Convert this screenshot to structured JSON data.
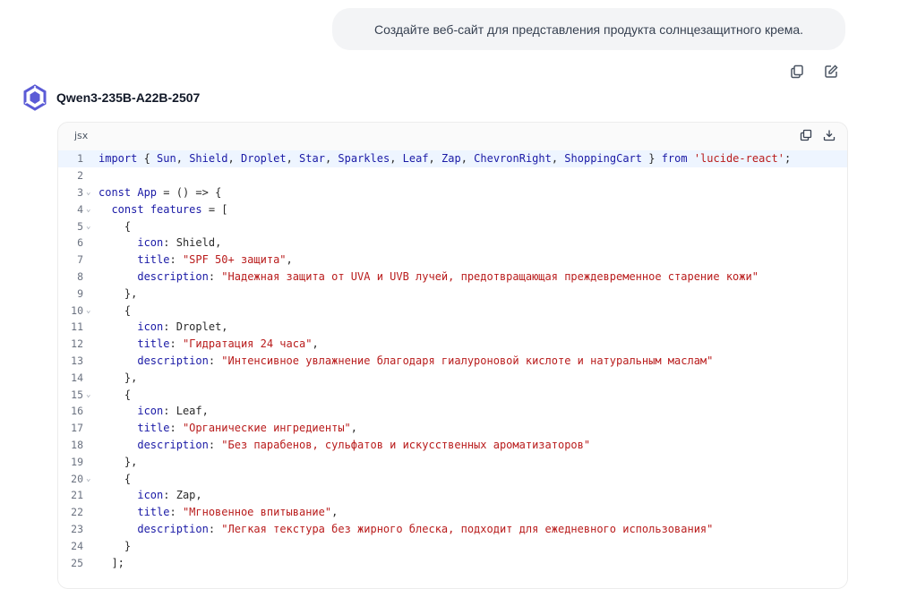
{
  "user_message": "Создайте веб-сайт для представления продукта солнцезащитного крема.",
  "assistant": {
    "model_name": "Qwen3-235B-A22B-2507"
  },
  "icons": {
    "copy": "copy-icon",
    "edit": "edit-icon",
    "download": "download-icon",
    "logo": "qwen-logo-icon",
    "fold": "chevron-down-icon"
  },
  "colors": {
    "keyword": "#1a1aa6",
    "string": "#b91c1c",
    "line_highlight": "#eef5ff",
    "bubble_bg": "#f3f4f6",
    "logo": "#5b5bd6"
  },
  "code_block": {
    "language": "jsx",
    "active_line": 1,
    "lines": [
      {
        "n": "1",
        "fold": false,
        "tokens": [
          [
            "kw",
            "import"
          ],
          [
            "p",
            " { "
          ],
          [
            "id",
            "Sun"
          ],
          [
            "p",
            ", "
          ],
          [
            "id",
            "Shield"
          ],
          [
            "p",
            ", "
          ],
          [
            "id",
            "Droplet"
          ],
          [
            "p",
            ", "
          ],
          [
            "id",
            "Star"
          ],
          [
            "p",
            ", "
          ],
          [
            "id",
            "Sparkles"
          ],
          [
            "p",
            ", "
          ],
          [
            "id",
            "Leaf"
          ],
          [
            "p",
            ", "
          ],
          [
            "id",
            "Zap"
          ],
          [
            "p",
            ", "
          ],
          [
            "id",
            "ChevronRight"
          ],
          [
            "p",
            ", "
          ],
          [
            "id",
            "ShoppingCart"
          ],
          [
            "p",
            " } "
          ],
          [
            "kw",
            "from"
          ],
          [
            "p",
            " "
          ],
          [
            "str",
            "'lucide-react'"
          ],
          [
            "p",
            ";"
          ]
        ]
      },
      {
        "n": "2",
        "fold": false,
        "tokens": []
      },
      {
        "n": "3",
        "fold": true,
        "tokens": [
          [
            "kw",
            "const"
          ],
          [
            "p",
            " "
          ],
          [
            "id",
            "App"
          ],
          [
            "p",
            " = () => {"
          ]
        ]
      },
      {
        "n": "4",
        "fold": true,
        "tokens": [
          [
            "p",
            "  "
          ],
          [
            "kw",
            "const"
          ],
          [
            "p",
            " "
          ],
          [
            "id",
            "features"
          ],
          [
            "p",
            " = ["
          ]
        ]
      },
      {
        "n": "5",
        "fold": true,
        "tokens": [
          [
            "p",
            "    {"
          ]
        ]
      },
      {
        "n": "6",
        "fold": false,
        "tokens": [
          [
            "p",
            "      "
          ],
          [
            "prop",
            "icon"
          ],
          [
            "p",
            ": "
          ],
          [
            "txt",
            "Shield"
          ],
          [
            "p",
            ","
          ]
        ]
      },
      {
        "n": "7",
        "fold": false,
        "tokens": [
          [
            "p",
            "      "
          ],
          [
            "prop",
            "title"
          ],
          [
            "p",
            ": "
          ],
          [
            "str",
            "\"SPF 50+ защита\""
          ],
          [
            "p",
            ","
          ]
        ]
      },
      {
        "n": "8",
        "fold": false,
        "tokens": [
          [
            "p",
            "      "
          ],
          [
            "prop",
            "description"
          ],
          [
            "p",
            ": "
          ],
          [
            "str",
            "\"Надежная защита от UVA и UVB лучей, предотвращающая преждевременное старение кожи\""
          ]
        ]
      },
      {
        "n": "9",
        "fold": false,
        "tokens": [
          [
            "p",
            "    },"
          ]
        ]
      },
      {
        "n": "10",
        "fold": true,
        "tokens": [
          [
            "p",
            "    {"
          ]
        ]
      },
      {
        "n": "11",
        "fold": false,
        "tokens": [
          [
            "p",
            "      "
          ],
          [
            "prop",
            "icon"
          ],
          [
            "p",
            ": "
          ],
          [
            "txt",
            "Droplet"
          ],
          [
            "p",
            ","
          ]
        ]
      },
      {
        "n": "12",
        "fold": false,
        "tokens": [
          [
            "p",
            "      "
          ],
          [
            "prop",
            "title"
          ],
          [
            "p",
            ": "
          ],
          [
            "str",
            "\"Гидратация 24 часа\""
          ],
          [
            "p",
            ","
          ]
        ]
      },
      {
        "n": "13",
        "fold": false,
        "tokens": [
          [
            "p",
            "      "
          ],
          [
            "prop",
            "description"
          ],
          [
            "p",
            ": "
          ],
          [
            "str",
            "\"Интенсивное увлажнение благодаря гиалуроновой кислоте и натуральным маслам\""
          ]
        ]
      },
      {
        "n": "14",
        "fold": false,
        "tokens": [
          [
            "p",
            "    },"
          ]
        ]
      },
      {
        "n": "15",
        "fold": true,
        "tokens": [
          [
            "p",
            "    {"
          ]
        ]
      },
      {
        "n": "16",
        "fold": false,
        "tokens": [
          [
            "p",
            "      "
          ],
          [
            "prop",
            "icon"
          ],
          [
            "p",
            ": "
          ],
          [
            "txt",
            "Leaf"
          ],
          [
            "p",
            ","
          ]
        ]
      },
      {
        "n": "17",
        "fold": false,
        "tokens": [
          [
            "p",
            "      "
          ],
          [
            "prop",
            "title"
          ],
          [
            "p",
            ": "
          ],
          [
            "str",
            "\"Органические ингредиенты\""
          ],
          [
            "p",
            ","
          ]
        ]
      },
      {
        "n": "18",
        "fold": false,
        "tokens": [
          [
            "p",
            "      "
          ],
          [
            "prop",
            "description"
          ],
          [
            "p",
            ": "
          ],
          [
            "str",
            "\"Без парабенов, сульфатов и искусственных ароматизаторов\""
          ]
        ]
      },
      {
        "n": "19",
        "fold": false,
        "tokens": [
          [
            "p",
            "    },"
          ]
        ]
      },
      {
        "n": "20",
        "fold": true,
        "tokens": [
          [
            "p",
            "    {"
          ]
        ]
      },
      {
        "n": "21",
        "fold": false,
        "tokens": [
          [
            "p",
            "      "
          ],
          [
            "prop",
            "icon"
          ],
          [
            "p",
            ": "
          ],
          [
            "txt",
            "Zap"
          ],
          [
            "p",
            ","
          ]
        ]
      },
      {
        "n": "22",
        "fold": false,
        "tokens": [
          [
            "p",
            "      "
          ],
          [
            "prop",
            "title"
          ],
          [
            "p",
            ": "
          ],
          [
            "str",
            "\"Мгновенное впитывание\""
          ],
          [
            "p",
            ","
          ]
        ]
      },
      {
        "n": "23",
        "fold": false,
        "tokens": [
          [
            "p",
            "      "
          ],
          [
            "prop",
            "description"
          ],
          [
            "p",
            ": "
          ],
          [
            "str",
            "\"Легкая текстура без жирного блеска, подходит для ежедневного использования\""
          ]
        ]
      },
      {
        "n": "24",
        "fold": false,
        "tokens": [
          [
            "p",
            "    }"
          ]
        ]
      },
      {
        "n": "25",
        "fold": false,
        "tokens": [
          [
            "p",
            "  ];"
          ]
        ]
      }
    ]
  }
}
